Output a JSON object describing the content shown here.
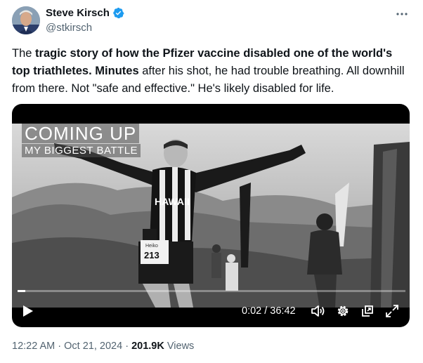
{
  "author": {
    "name": "Steve Kirsch",
    "handle": "@stkirsch",
    "verified": true,
    "badge_color": "#1d9bf0"
  },
  "more_icon": "more-horizontal-icon",
  "tweet": {
    "t1": "The ",
    "b1": "tragic story of how the Pfizer vaccine disabled one of the world's top triathletes.",
    "t2": " ",
    "b2": "Minutes",
    "t3": " after his shot, he had trouble breathing. All downhill from there. Not \"safe and effective.\" He's likely disabled for life."
  },
  "video": {
    "overlay_title": "COMING UP",
    "overlay_subtitle": "MY BIGGEST BATTLE",
    "jersey_text": "HAWAII",
    "bib_name": "Heiko",
    "bib_number": "213",
    "time_display": "0:02 / 36:42",
    "progress_fraction": 0.001,
    "controls": [
      "play-icon",
      "volume-icon",
      "settings-gear-icon",
      "picture-in-picture-icon",
      "fullscreen-icon"
    ]
  },
  "meta": {
    "time": "12:22 AM",
    "separator1": " · ",
    "date": "Oct 21, 2024",
    "separator2": " · ",
    "views_count": "201.9K",
    "views_label": " Views"
  }
}
